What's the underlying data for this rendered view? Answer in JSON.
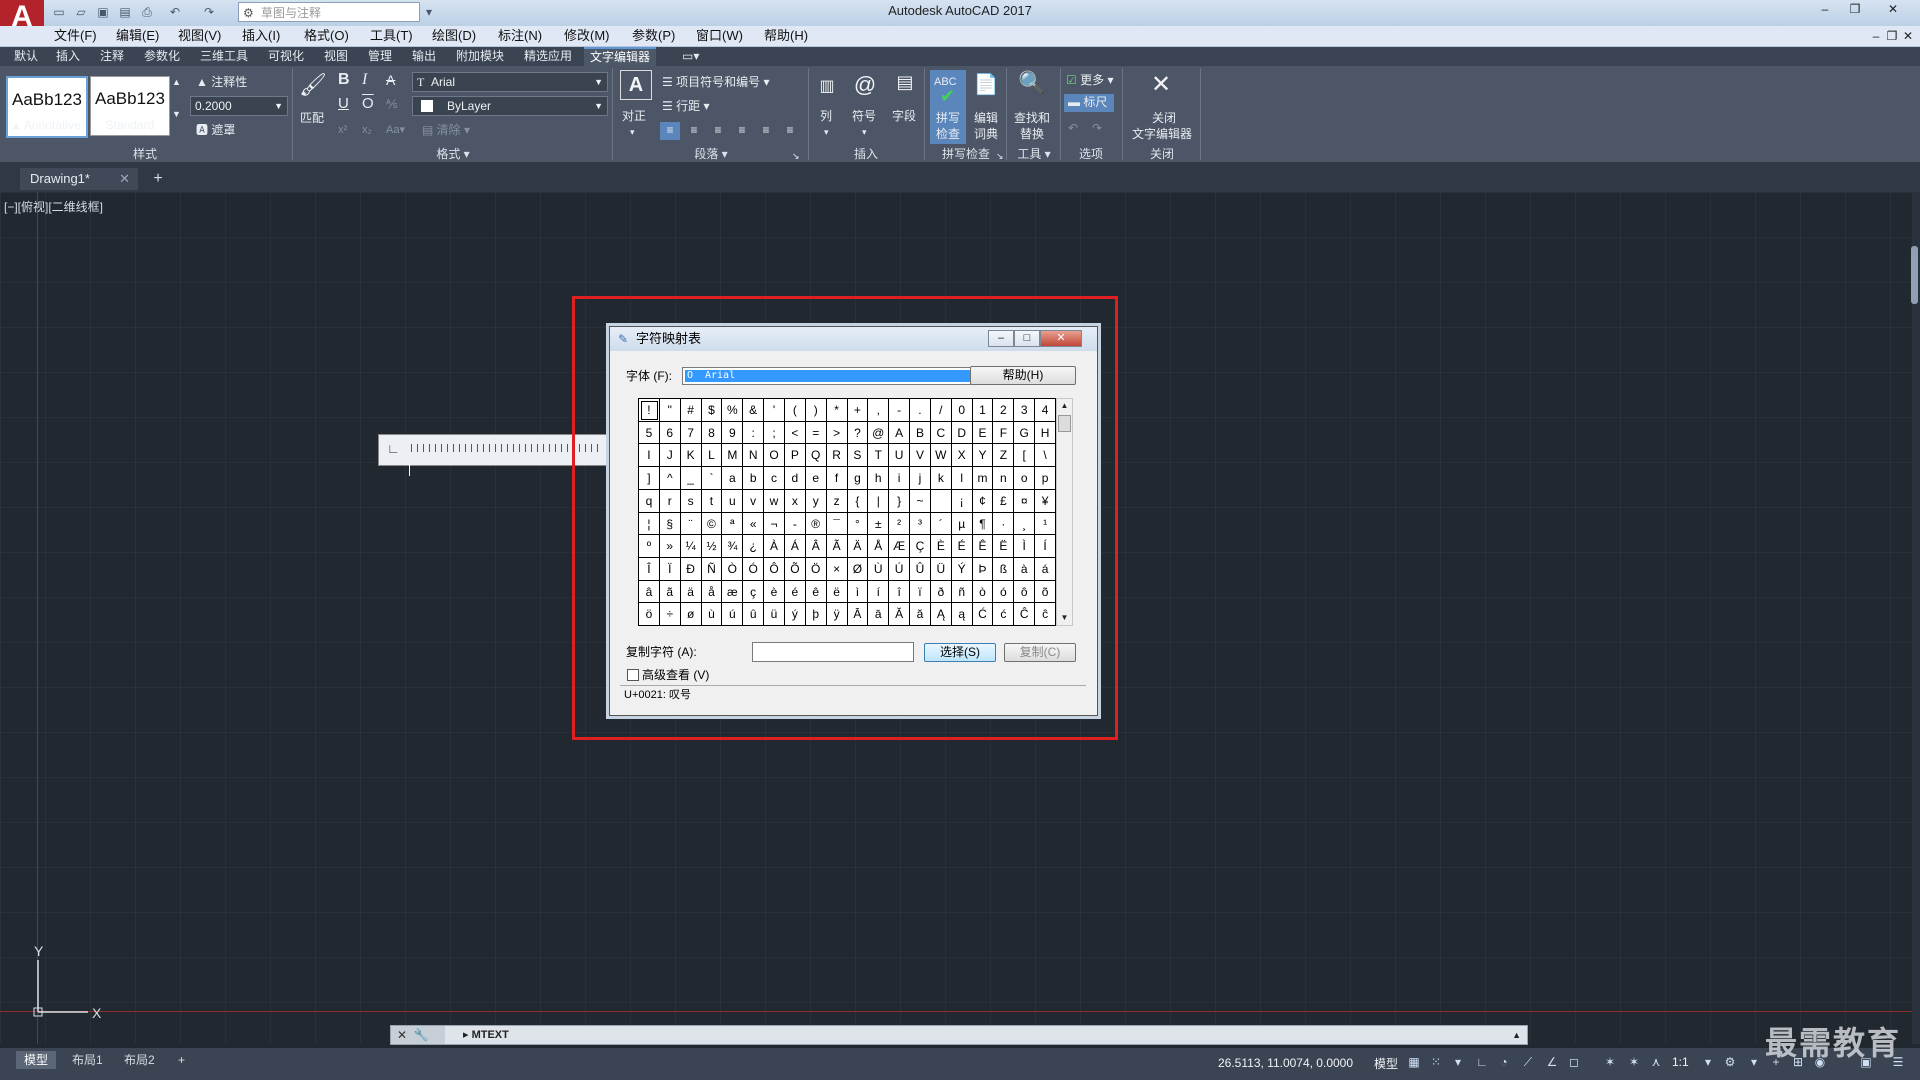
{
  "app": {
    "title": "Autodesk AutoCAD 2017",
    "logo_letter": "A",
    "workspace": "草图与注释",
    "window_controls": [
      "‒",
      "❐",
      "✕"
    ],
    "mdi_controls": [
      "‒",
      "❐",
      "✕"
    ]
  },
  "menubar": [
    "文件(F)",
    "编辑(E)",
    "视图(V)",
    "插入(I)",
    "格式(O)",
    "工具(T)",
    "绘图(D)",
    "标注(N)",
    "修改(M)",
    "参数(P)",
    "窗口(W)",
    "帮助(H)"
  ],
  "ribbon_tabs": [
    "默认",
    "插入",
    "注释",
    "参数化",
    "三维工具",
    "可视化",
    "视图",
    "管理",
    "输出",
    "附加模块",
    "精选应用",
    "文字编辑器"
  ],
  "ribbon": {
    "style": {
      "sample1": "AaBb123",
      "label1": "Annotative",
      "sample2": "AaBb123",
      "label2": "Standard",
      "annotative": "注释性",
      "height": "0.2000",
      "mask": "遮罩",
      "title": "样式"
    },
    "format": {
      "match": "匹配",
      "bold": "B",
      "italic": "I",
      "strike": "A",
      "underline": "U",
      "overline": "O",
      "font": "Arial",
      "color": "ByLayer",
      "clear": "清除",
      "title": "格式"
    },
    "paragraph": {
      "justify": "对正",
      "bullets": "项目符号和编号",
      "linespacing": "行距",
      "title": "段落"
    },
    "insert": {
      "columns": "列",
      "symbol": "符号",
      "field": "字段",
      "title": "插入"
    },
    "spell": {
      "check_line1": "拼写",
      "check_line2": "检查",
      "dict_line1": "编辑",
      "dict_line2": "词典",
      "title": "拼写检查"
    },
    "tools": {
      "find_line1": "查找和",
      "find_line2": "替换",
      "title": "工具"
    },
    "options": {
      "more": "更多",
      "ruler": "标尺",
      "title": "选项"
    },
    "close": {
      "line1": "关闭",
      "line2": "文字编辑器",
      "title": "关闭"
    }
  },
  "doc_tab": {
    "name": "Drawing1*",
    "close": "✕",
    "new": "+"
  },
  "viewport": {
    "label": "[−][俯视][二维线框]",
    "ucs_x": "X",
    "ucs_y": "Y"
  },
  "charmap": {
    "title": "字符映射表",
    "font_label": "字体 (F):",
    "font_value": "Arial",
    "help": "帮助(H)",
    "copy_label": "复制字符 (A):",
    "select": "选择(S)",
    "copy": "复制(C)",
    "advanced": "高级查看 (V)",
    "status": "U+0021: 叹号",
    "rows": [
      [
        "!",
        "\"",
        "#",
        "$",
        "%",
        "&",
        "'",
        "(",
        ")",
        "*",
        "+",
        ",",
        "-",
        ".",
        "/",
        "0",
        "1",
        "2",
        "3",
        "4"
      ],
      [
        "5",
        "6",
        "7",
        "8",
        "9",
        ":",
        ";",
        "<",
        "=",
        ">",
        "?",
        "@",
        "A",
        "B",
        "C",
        "D",
        "E",
        "F",
        "G",
        "H"
      ],
      [
        "I",
        "J",
        "K",
        "L",
        "M",
        "N",
        "O",
        "P",
        "Q",
        "R",
        "S",
        "T",
        "U",
        "V",
        "W",
        "X",
        "Y",
        "Z",
        "[",
        "\\"
      ],
      [
        "]",
        "^",
        "_",
        "`",
        "a",
        "b",
        "c",
        "d",
        "e",
        "f",
        "g",
        "h",
        "i",
        "j",
        "k",
        "l",
        "m",
        "n",
        "o",
        "p"
      ],
      [
        "q",
        "r",
        "s",
        "t",
        "u",
        "v",
        "w",
        "x",
        "y",
        "z",
        "{",
        "|",
        "}",
        "~",
        " ",
        "¡",
        "¢",
        "£",
        "¤",
        "¥"
      ],
      [
        "¦",
        "§",
        "¨",
        "©",
        "ª",
        "«",
        "¬",
        "-",
        "®",
        "¯",
        "°",
        "±",
        "²",
        "³",
        "´",
        "µ",
        "¶",
        "·",
        "¸",
        "¹"
      ],
      [
        "º",
        "»",
        "¼",
        "½",
        "¾",
        "¿",
        "À",
        "Á",
        "Â",
        "Ã",
        "Ä",
        "Å",
        "Æ",
        "Ç",
        "È",
        "É",
        "Ê",
        "Ë",
        "Ì",
        "Í"
      ],
      [
        "Î",
        "Ï",
        "Ð",
        "Ñ",
        "Ò",
        "Ó",
        "Ô",
        "Õ",
        "Ö",
        "×",
        "Ø",
        "Ù",
        "Ú",
        "Û",
        "Ü",
        "Ý",
        "Þ",
        "ß",
        "à",
        "á"
      ],
      [
        "â",
        "ã",
        "ä",
        "å",
        "æ",
        "ç",
        "è",
        "é",
        "ê",
        "ë",
        "ì",
        "í",
        "î",
        "ï",
        "ð",
        "ñ",
        "ò",
        "ó",
        "ô",
        "õ"
      ],
      [
        "ö",
        "÷",
        "ø",
        "ù",
        "ú",
        "û",
        "ü",
        "ý",
        "þ",
        "ÿ",
        "Ā",
        "ā",
        "Ă",
        "ă",
        "Ą",
        "ą",
        "Ć",
        "ć",
        "Ĉ",
        "ĉ"
      ]
    ]
  },
  "command": {
    "text": "MTEXT"
  },
  "status": {
    "layout_tabs": [
      "模型",
      "布局1",
      "布局2"
    ],
    "add": "+",
    "coords": "26.5113, 11.0074, 0.0000",
    "model": "模型",
    "scale": "1:1"
  },
  "watermark": "最需教育",
  "colors": {
    "highlight_box": "#e02020",
    "ribbon_bg": "#4c5666",
    "canvas_bg": "#212830",
    "selection_blue": "#3399ff"
  }
}
